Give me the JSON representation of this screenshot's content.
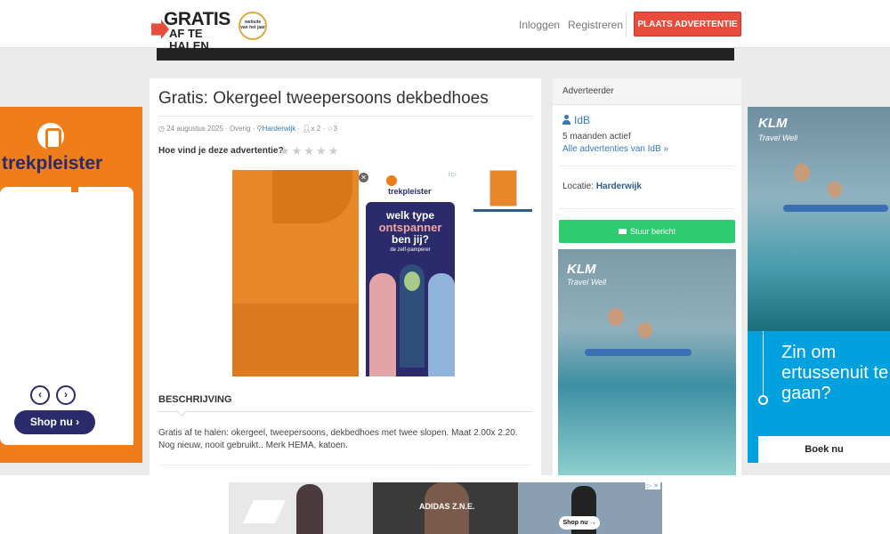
{
  "header": {
    "logo_line1": "GRATIS",
    "logo_line2": "AF TE HALEN",
    "badge_text": "website van het jaar",
    "login": "Inloggen",
    "register": "Registreren",
    "place_ad": "PLAATS ADVERTENTIE"
  },
  "listing": {
    "title": "Gratis: Okergeel tweepersoons dekbedhoes",
    "date": "24 augustus 2025",
    "category": "Overig",
    "location": "Harderwijk",
    "views": "x 2",
    "favorites": "3",
    "rating_prompt": "Hoe vind je deze advertentie?",
    "rating_stars": "★★★★★",
    "description_heading": "BESCHRIJVING",
    "description": "Gratis af te halen: okergeel, tweepersoons, dekbedhoes met twee slopen. Maat 2.00x 2.20. Nog nieuw, nooit gebruikt.. Merk HEMA, katoen."
  },
  "advertiser": {
    "heading": "Adverteerder",
    "name": "IdB",
    "active": "5 maanden actief",
    "all_ads": "Alle advertenties van IdB »",
    "location_label": "Locatie:",
    "location": "Harderwijk",
    "send_message": "Stuur bericht"
  },
  "ads": {
    "trekpleister_name": "trekpleister",
    "trekpleister_shop": "Shop nu",
    "inner_ad_brand": "trekpleister",
    "inner_ad_line1": "welk type",
    "inner_ad_line2": "ontspanner",
    "inner_ad_line3": "ben jij?",
    "inner_ad_line4": "de zelf-pamperer",
    "klm_brand": "KLM",
    "klm_tagline": "Travel Well",
    "klm_headline": "Zin om ertussenuit te gaan?",
    "klm_cta": "Boek nu",
    "adidas_label": "ADIDAS Z.N.E.",
    "adidas_shop": "Shop nu"
  },
  "colors": {
    "accent": "#e74c3c",
    "link": "#337ab7",
    "send": "#2ecc71",
    "trekpleister_orange": "#ef7d1a",
    "trekpleister_navy": "#2b2a6b",
    "klm_blue": "#00a1de"
  }
}
